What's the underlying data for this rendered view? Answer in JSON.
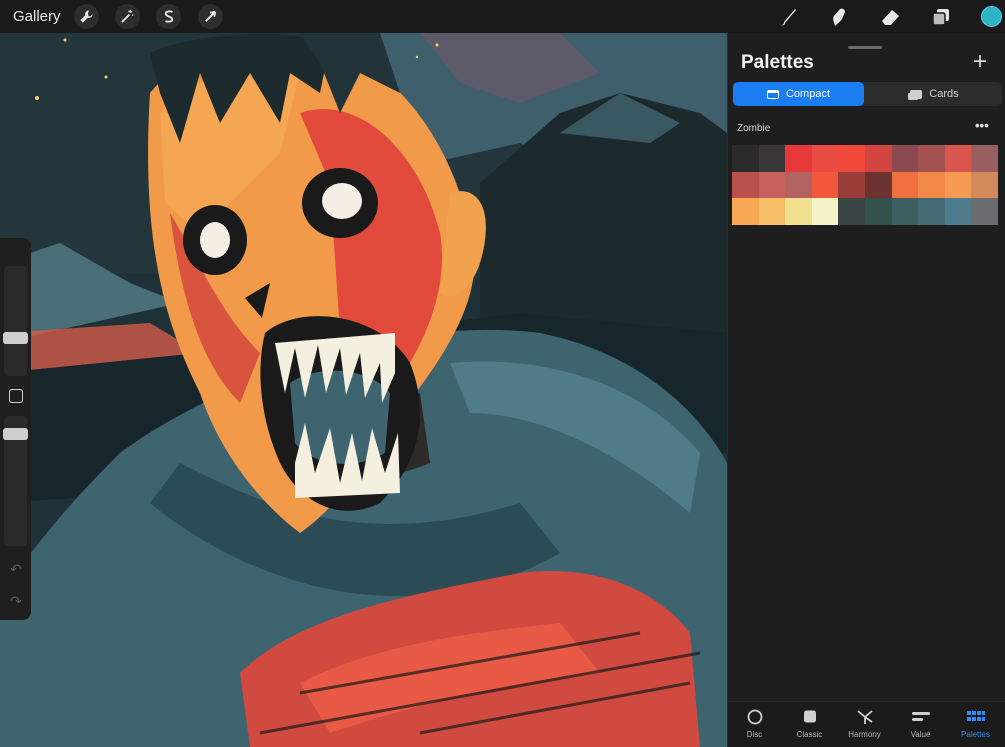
{
  "toolbar": {
    "gallery_label": "Gallery",
    "left_icons": [
      "wrench-icon",
      "magic-wand-icon",
      "selection-s-icon",
      "transform-arrow-icon"
    ],
    "right_icons": [
      "brush-icon",
      "smudge-icon",
      "eraser-icon",
      "layers-icon"
    ],
    "current_color": "#2fb3c7"
  },
  "panel": {
    "title": "Palettes",
    "add_label": "+",
    "segments": {
      "compact": "Compact",
      "cards": "Cards",
      "selected": "Compact"
    },
    "palette_name": "Zombie",
    "more_label": "•••",
    "swatches": [
      "#2a2a2a",
      "#393737",
      "#e8393a",
      "#e84a44",
      "#f0493c",
      "#d2443f",
      "#8a4a4f",
      "#a35250",
      "#d8564e",
      "#9a5f5f",
      "#b9504c",
      "#c7605c",
      "#b1645f",
      "#f2583c",
      "#9a3c38",
      "#6b3431",
      "#f0703f",
      "#f4874a",
      "#f49a52",
      "#d4895a",
      "#f6a852",
      "#f6be67",
      "#f0e08e",
      "#f4f2c8",
      "#3a4544",
      "#35514e",
      "#3e5e5f",
      "#446b73",
      "#4e7c8c",
      "#6a6c70"
    ]
  },
  "tabs": [
    {
      "label": "Disc",
      "icon": "circle-icon"
    },
    {
      "label": "Classic",
      "icon": "square-icon"
    },
    {
      "label": "Harmony",
      "icon": "harmony-icon"
    },
    {
      "label": "Value",
      "icon": "value-bars-icon"
    },
    {
      "label": "Palettes",
      "icon": "grid-dots-icon",
      "active": true
    }
  ],
  "sidebar": {
    "undo_icon": "undo-icon",
    "redo_icon": "redo-icon"
  }
}
